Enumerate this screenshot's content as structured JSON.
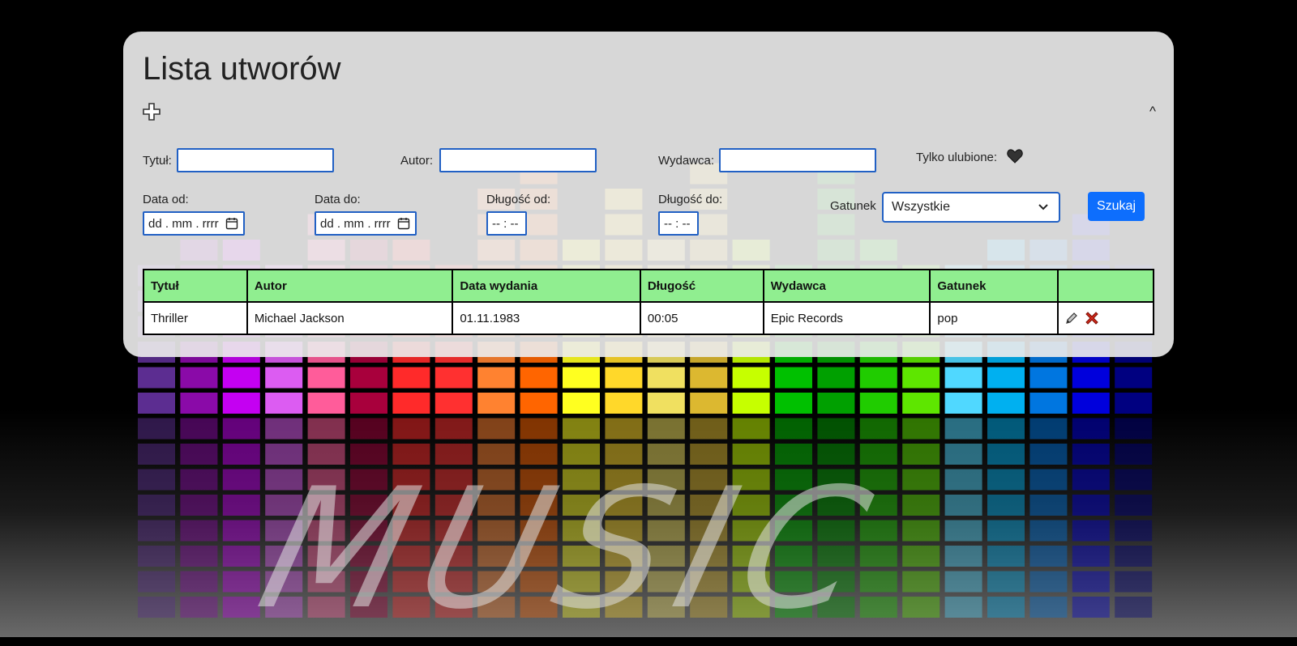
{
  "page": {
    "title": "Lista utworów"
  },
  "filters": {
    "title_label": "Tytuł:",
    "title_value": "",
    "author_label": "Autor:",
    "author_value": "",
    "publisher_label": "Wydawca:",
    "publisher_value": "",
    "favorites_label": "Tylko ulubione:",
    "date_from_label": "Data od:",
    "date_from_placeholder": "dd . mm . rrrr",
    "date_to_label": "Data do:",
    "date_to_placeholder": "dd . mm . rrrr",
    "length_from_label": "Długość od:",
    "length_from_placeholder": "-- : --",
    "length_to_label": "Długość do:",
    "length_to_placeholder": "-- : --",
    "genre_label": "Gatunek",
    "genre_selected": "Wszystkie",
    "search_button": "Szukaj"
  },
  "table": {
    "headers": [
      "Tytuł",
      "Autor",
      "Data wydania",
      "Długość",
      "Wydawca",
      "Gatunek",
      ""
    ],
    "rows": [
      {
        "title": "Thriller",
        "author": "Michael Jackson",
        "date": "01.11.1983",
        "length": "00:05",
        "publisher": "Epic Records",
        "genre": "pop"
      }
    ]
  },
  "icons": {
    "add": "plus-icon",
    "collapse": "caret-up-icon",
    "favorite": "heart-icon",
    "edit": "pencil-icon",
    "delete": "close-x-icon",
    "calendar": "calendar-icon"
  },
  "background": {
    "watermark": "MUSIC",
    "eq_colors": [
      "#5c2d91",
      "#8a0aa8",
      "#c400f2",
      "#dc5cf2",
      "#ff5c9a",
      "#a8003c",
      "#ff2a2a",
      "#ff3030",
      "#ff8230",
      "#ff6500",
      "#ffff20",
      "#ffd82a",
      "#f0e060",
      "#dcb830",
      "#c6ff00",
      "#00c000",
      "#00a000",
      "#20cc00",
      "#5ee600",
      "#50d8ff",
      "#00b0f0",
      "#0076e0",
      "#0000dc",
      "#000080"
    ]
  },
  "colors": {
    "accent": "#0d6efd",
    "table_header": "#90ee90",
    "input_border": "#2160c4"
  }
}
